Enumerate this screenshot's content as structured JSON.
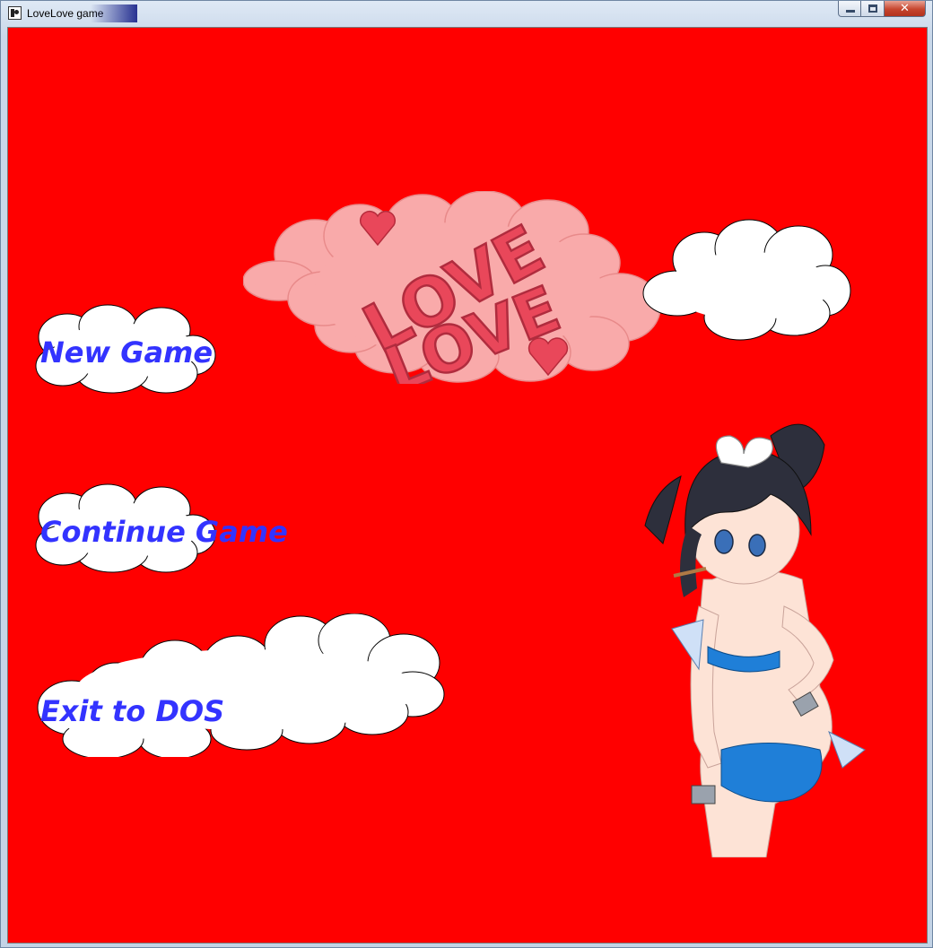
{
  "window": {
    "title": "LoveLove game",
    "buttons": [
      "minimize",
      "maximize",
      "close"
    ],
    "close_glyph": "✕"
  },
  "menu": {
    "items": [
      {
        "id": "new-game",
        "label": "New Game"
      },
      {
        "id": "continue-game",
        "label": "Continue Game"
      },
      {
        "id": "exit-to-dos",
        "label": "Exit to DOS"
      }
    ]
  },
  "logo": {
    "line1": "LOVE",
    "line2": "LOVE"
  },
  "colors": {
    "background": "#ff0000",
    "menu_text": "#3333ff",
    "logo_cloud": "#f9aaaa",
    "logo_letters": "#e9475a",
    "cloud_fill": "#ffffff"
  },
  "icons": {
    "app": "app-icon",
    "minimize": "minimize-icon",
    "maximize": "maximize-icon",
    "close": "close-icon"
  }
}
